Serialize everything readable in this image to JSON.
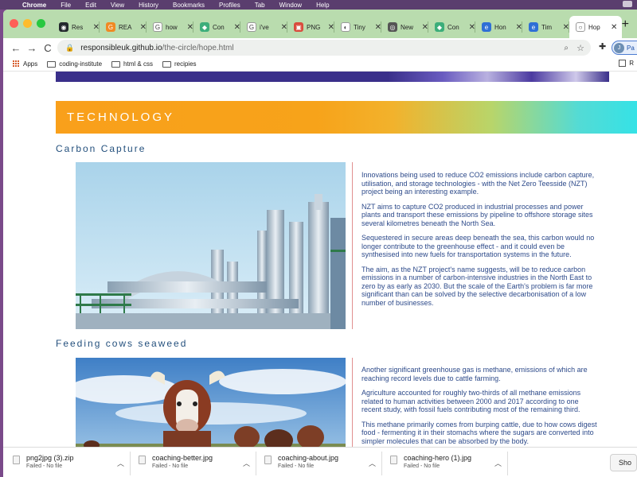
{
  "menubar": {
    "apple": "",
    "app": "Chrome",
    "items": [
      "File",
      "Edit",
      "View",
      "History",
      "Bookmarks",
      "Profiles",
      "Tab",
      "Window",
      "Help"
    ]
  },
  "tabs": [
    {
      "label": "Res",
      "icon": "github-icon",
      "color": "#24292e",
      "glyph": "◉"
    },
    {
      "label": "REA",
      "icon": "github-icon",
      "color": "#f08a24",
      "glyph": "G"
    },
    {
      "label": "how",
      "icon": "google-icon",
      "color": "#ffffff",
      "glyph": "G"
    },
    {
      "label": "Con",
      "icon": "leaf-icon",
      "color": "#3cae7a",
      "glyph": "◆"
    },
    {
      "label": "i've",
      "icon": "google-icon",
      "color": "#ffffff",
      "glyph": "G"
    },
    {
      "label": "PNG",
      "icon": "png-icon",
      "color": "#d94c3d",
      "glyph": "▣"
    },
    {
      "label": "Tiny",
      "icon": "panda-icon",
      "color": "#ffffff",
      "glyph": "◐"
    },
    {
      "label": "New",
      "icon": "chrome-icon",
      "color": "#555555",
      "glyph": "◎"
    },
    {
      "label": "Con",
      "icon": "leaf-icon",
      "color": "#3cae7a",
      "glyph": "◆"
    },
    {
      "label": "Hon",
      "icon": "time-icon",
      "color": "#2f6fd6",
      "glyph": "e"
    },
    {
      "label": "Tim",
      "icon": "time-icon",
      "color": "#2f6fd6",
      "glyph": "e"
    },
    {
      "label": "Hop",
      "icon": "globe-icon",
      "color": "#ffffff",
      "glyph": "○",
      "active": true
    }
  ],
  "toolbar": {
    "back": "←",
    "forward": "→",
    "reload": "C",
    "url_host": "responsibleuk.github.io",
    "url_path": "/the-circle/hope.html",
    "profile_initial": "J",
    "profile_label": "Pa"
  },
  "bookmarks": {
    "apps": "Apps",
    "items": [
      "coding-institute",
      "html & css",
      "recipies"
    ],
    "reading_list": "R"
  },
  "page": {
    "banner_title": "TECHNOLOGY",
    "sections": [
      {
        "heading": "Carbon Capture",
        "image": "industrial-plant-photo",
        "paragraphs": [
          "Innovations being used to reduce CO2 emissions include carbon capture, utilisation, and storage technologies - with the Net Zero Teesside (NZT) project being an interesting example.",
          "NZT aims to capture CO2 produced in industrial processes and power plants and transport these emissions by pipeline to offshore storage sites several kilometres beneath the North Sea.",
          "Sequestered in secure areas deep beneath the sea, this carbon would no longer contribute to the greenhouse effect - and it could even be synthesised into new fuels for transportation systems in the future.",
          "The aim, as the NZT project's name suggests, will be to reduce carbon emissions in a number of carbon-intensive industries in the North East to zero by as early as 2030. But the scale of the Earth's problem is far more significant than can be solved by the selective decarbonisation of a low number of businesses."
        ]
      },
      {
        "heading": "Feeding cows seaweed",
        "image": "cows-in-field-photo",
        "paragraphs": [
          "Another significant greenhouse gas is methane, emissions of which are reaching record levels due to cattle farming.",
          "Agriculture accounted for roughly two-thirds of all methane emissions related to human activities between 2000 and 2017 according to one recent study, with fossil fuels contributing most of the remaining third.",
          "This methane primarily comes from burping cattle, due to how cows digest food - fermenting it in their stomachs where the sugars are converted into simpler molecules that can be absorbed by the body."
        ]
      }
    ]
  },
  "downloads": [
    {
      "name": "png2jpg (3).zip",
      "status": "Failed - No file"
    },
    {
      "name": "coaching-better.jpg",
      "status": "Failed - No file"
    },
    {
      "name": "coaching-about.jpg",
      "status": "Failed - No file"
    },
    {
      "name": "coaching-hero (1).jpg",
      "status": "Failed - No file"
    }
  ],
  "show_all": "Sho"
}
